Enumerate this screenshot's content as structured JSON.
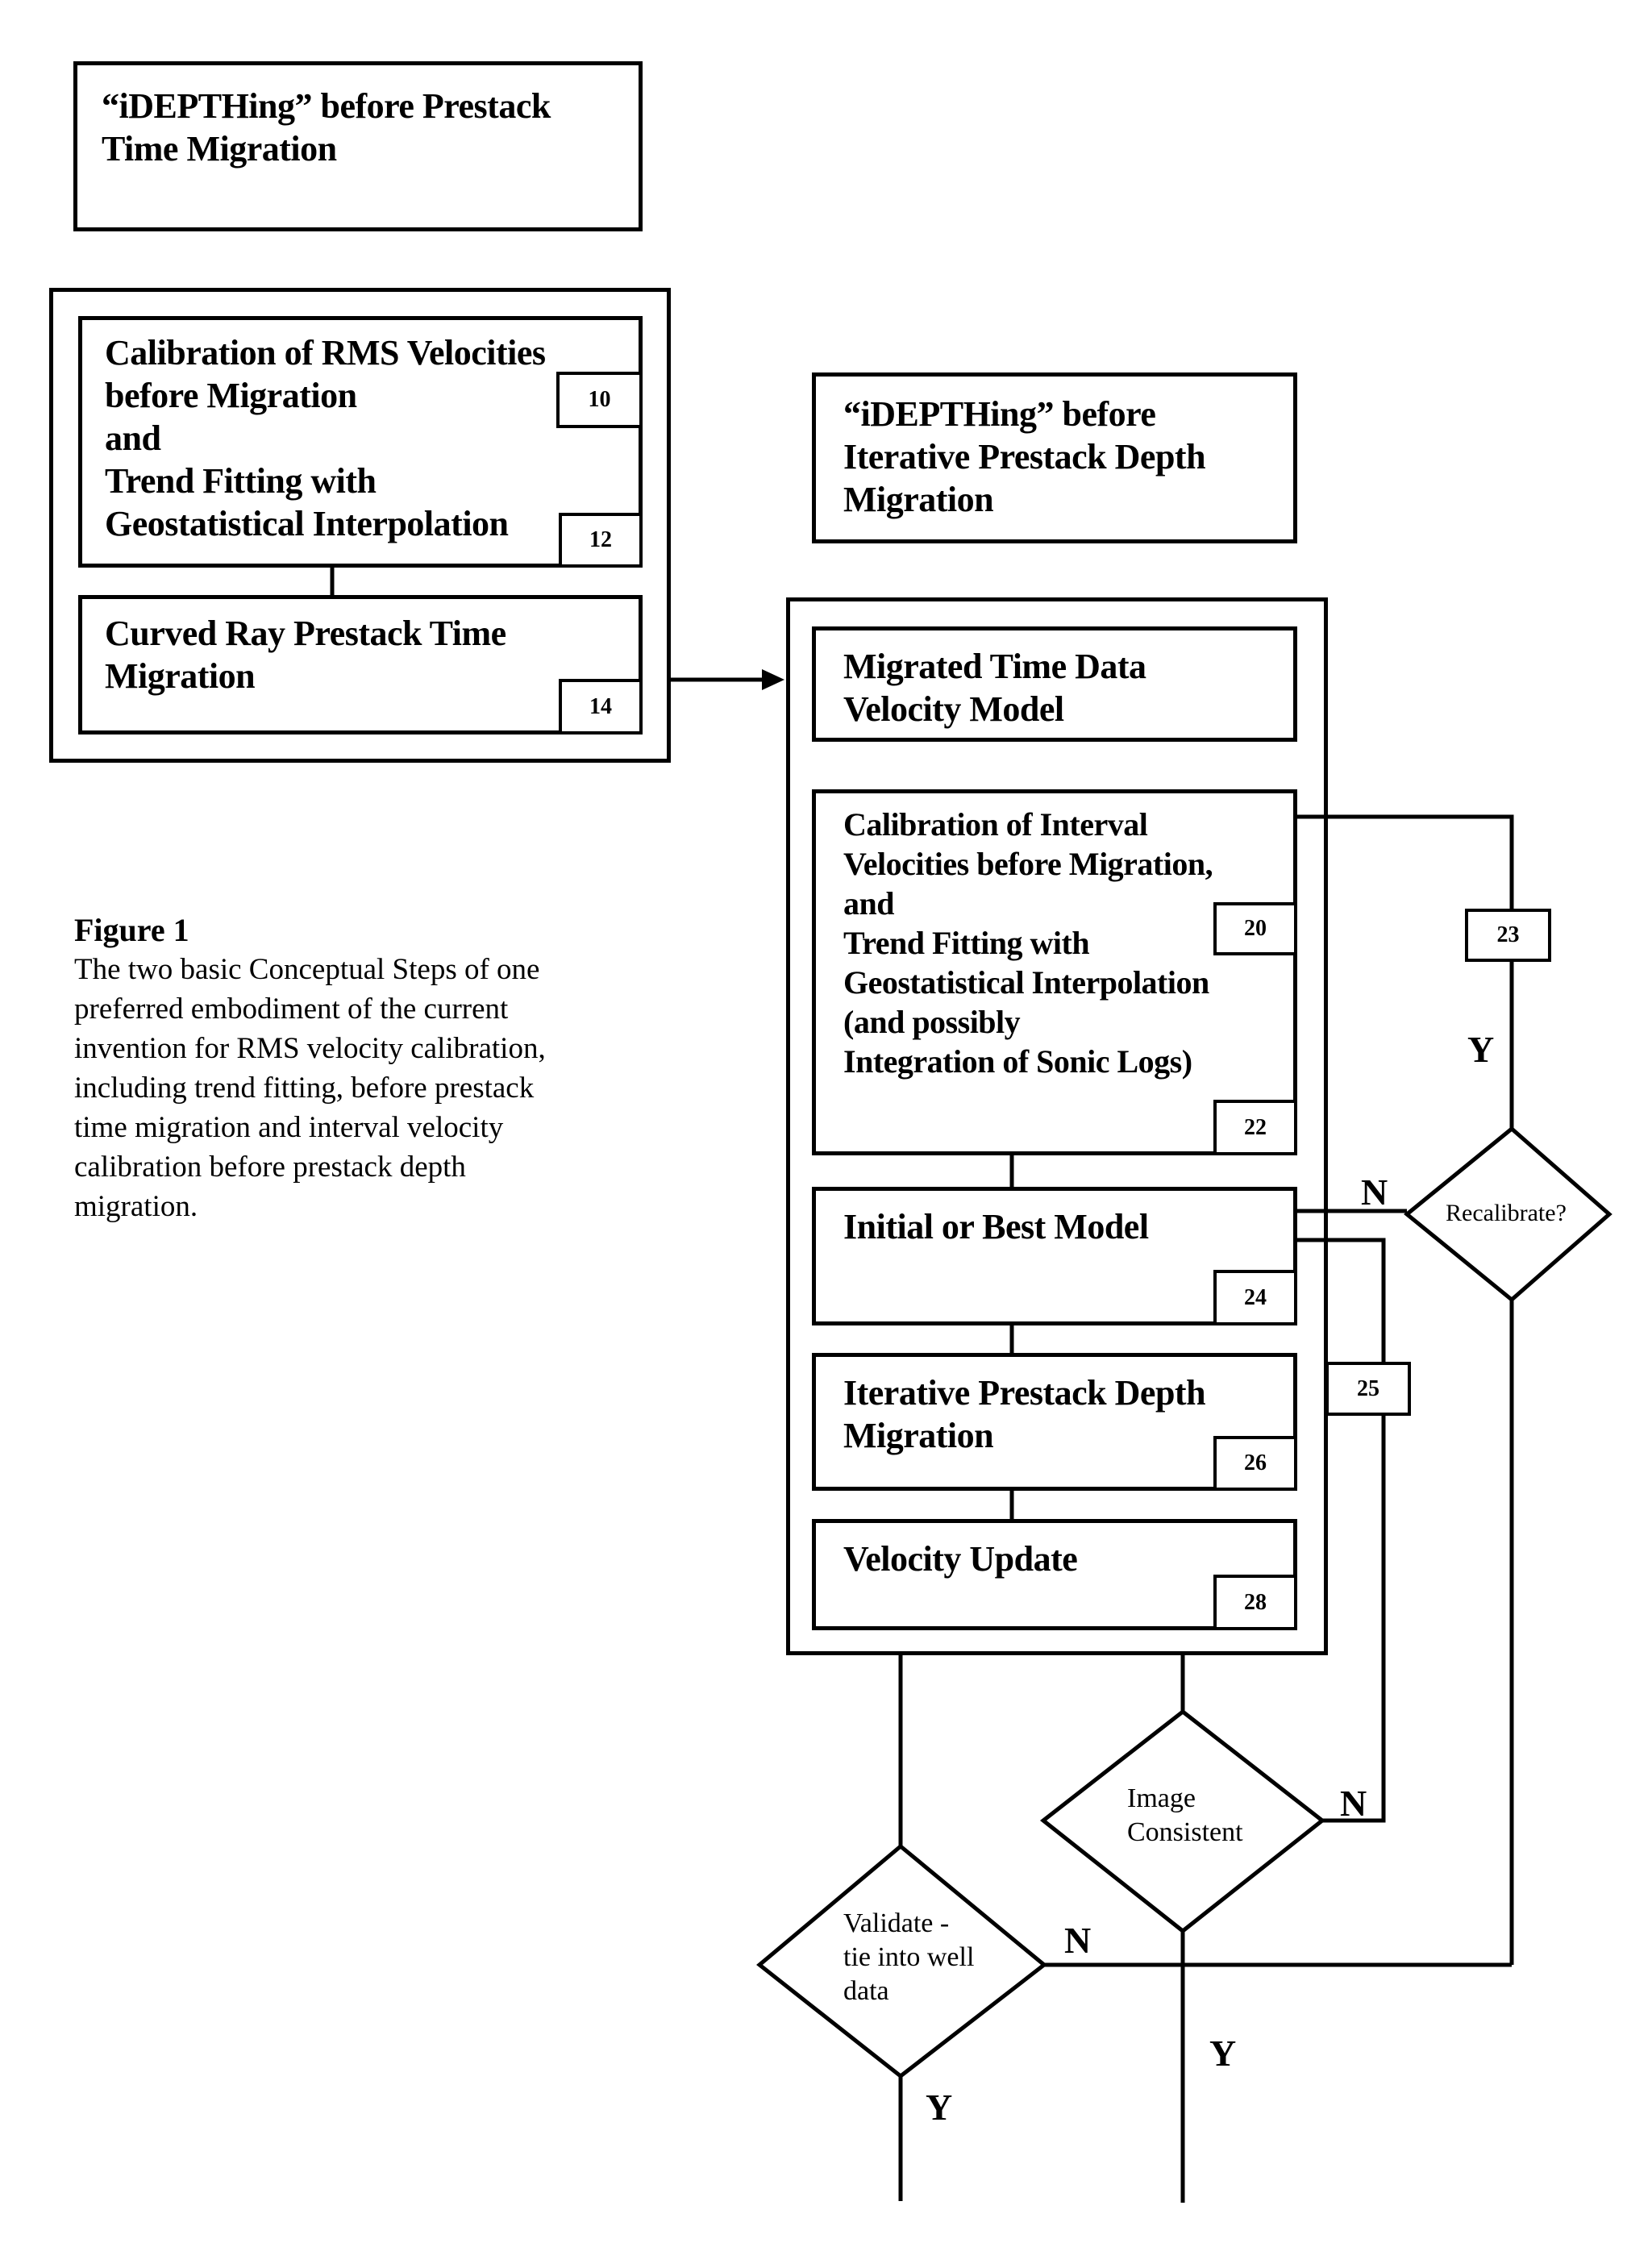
{
  "diagram": {
    "left_title": "“iDEPTHing” before Prestack\nTime Migration",
    "right_title": "“iDEPTHing” before\nIterative Prestack Depth\nMigration",
    "left_steps": [
      {
        "text": "Calibration of RMS Velocities\nbefore Migration\nand\nTrend Fitting with\nGeostatistical Interpolation",
        "refs": [
          "10",
          "12"
        ]
      },
      {
        "text": "Curved Ray Prestack Time\nMigration",
        "refs": [
          "14"
        ]
      }
    ],
    "right_steps": [
      {
        "text": "Migrated Time Data\nVelocity Model",
        "refs": []
      },
      {
        "text": "Calibration of Interval\nVelocities before Migration,\nand\nTrend Fitting with\nGeostatistical Interpolation\n(and possibly\nIntegration of Sonic Logs)",
        "refs": [
          "20",
          "22"
        ]
      },
      {
        "text": "Initial or Best Model",
        "refs": [
          "24"
        ]
      },
      {
        "text": "Iterative Prestack Depth\nMigration",
        "refs": [
          "26"
        ]
      },
      {
        "text": "Velocity Update",
        "refs": [
          "28"
        ]
      }
    ],
    "loop_refs": {
      "recalibrate_loop": "23",
      "image_loop": "25"
    },
    "decisions": {
      "recalibrate": "Recalibrate?",
      "image_consistent": "Image\nConsistent",
      "validate": "Validate -\ntie into well\ndata"
    },
    "branch_labels": {
      "recal_yes": "Y",
      "recal_no": "N",
      "image_no": "N",
      "image_yes": "Y",
      "validate_no": "N",
      "validate_yes": "Y"
    }
  },
  "caption": {
    "title": "Figure 1",
    "body": "The two basic Conceptual Steps of one\npreferred embodiment of the current\ninvention for RMS velocity calibration,\nincluding trend fitting, before prestack\ntime migration and interval velocity\ncalibration before prestack depth\nmigration."
  }
}
